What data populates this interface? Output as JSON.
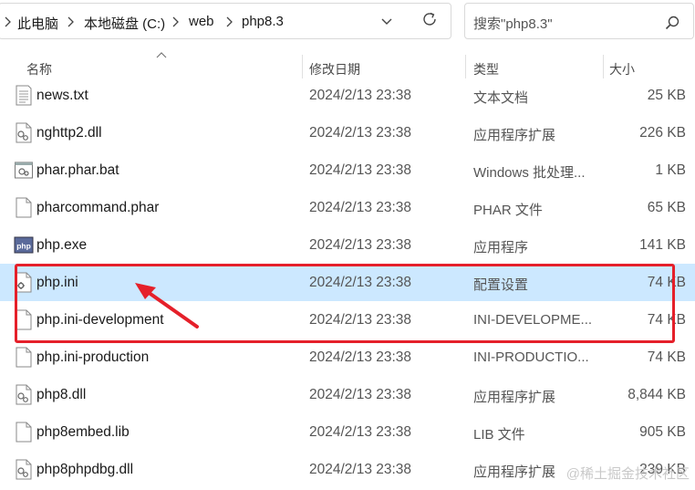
{
  "address_bar": {
    "crumbs": [
      "此电脑",
      "本地磁盘 (C:)",
      "web",
      "php8.3"
    ]
  },
  "search": {
    "placeholder": "搜索\"php8.3\""
  },
  "columns": {
    "name": "名称",
    "date": "修改日期",
    "type": "类型",
    "size": "大小"
  },
  "files": [
    {
      "name": "news.txt",
      "date": "2024/2/13 23:38",
      "type": "文本文档",
      "size": "25 KB",
      "icon": "text-file-icon"
    },
    {
      "name": "nghttp2.dll",
      "date": "2024/2/13 23:38",
      "type": "应用程序扩展",
      "size": "226 KB",
      "icon": "dll-file-icon"
    },
    {
      "name": "phar.phar.bat",
      "date": "2024/2/13 23:38",
      "type": "Windows 批处理...",
      "size": "1 KB",
      "icon": "batch-file-icon"
    },
    {
      "name": "pharcommand.phar",
      "date": "2024/2/13 23:38",
      "type": "PHAR 文件",
      "size": "65 KB",
      "icon": "blank-file-icon"
    },
    {
      "name": "php.exe",
      "date": "2024/2/13 23:38",
      "type": "应用程序",
      "size": "141 KB",
      "icon": "php-exe-icon"
    },
    {
      "name": "php.ini",
      "date": "2024/2/13 23:38",
      "type": "配置设置",
      "size": "74 KB",
      "icon": "config-file-icon",
      "selected": true
    },
    {
      "name": "php.ini-development",
      "date": "2024/2/13 23:38",
      "type": "INI-DEVELOPME...",
      "size": "74 KB",
      "icon": "blank-file-icon"
    },
    {
      "name": "php.ini-production",
      "date": "2024/2/13 23:38",
      "type": "INI-PRODUCTIO...",
      "size": "74 KB",
      "icon": "blank-file-icon"
    },
    {
      "name": "php8.dll",
      "date": "2024/2/13 23:38",
      "type": "应用程序扩展",
      "size": "8,844 KB",
      "icon": "dll-file-icon"
    },
    {
      "name": "php8embed.lib",
      "date": "2024/2/13 23:38",
      "type": "LIB 文件",
      "size": "905 KB",
      "icon": "blank-file-icon"
    },
    {
      "name": "php8phpdbg.dll",
      "date": "2024/2/13 23:38",
      "type": "应用程序扩展",
      "size": "239 KB",
      "icon": "dll-file-icon"
    }
  ],
  "exe_icon_text": "php",
  "watermark": "@稀土掘金技术社区",
  "colors": {
    "selection": "#cce8ff",
    "annotation": "#e5202a"
  }
}
